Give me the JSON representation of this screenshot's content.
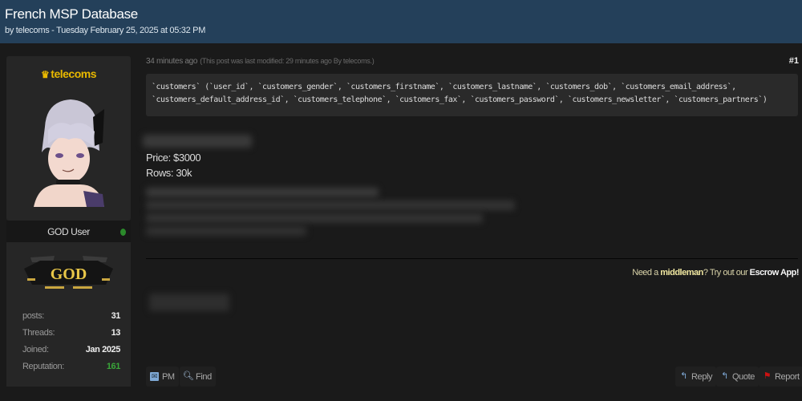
{
  "thread": {
    "title": "French MSP Database",
    "byline": "by telecoms - Tuesday February 25, 2025 at 05:32 PM"
  },
  "author": {
    "username": "telecoms",
    "crown_icon": "crown-icon",
    "rank_title": "GOD User",
    "online": true,
    "badge_text": "GOD",
    "stats": [
      {
        "label": "posts:",
        "value": "31"
      },
      {
        "label": "Threads:",
        "value": "13"
      },
      {
        "label": "Joined:",
        "value": "Jan 2025"
      },
      {
        "label": "Reputation:",
        "value": "161"
      }
    ],
    "reputation_color": "#3aa53a"
  },
  "post": {
    "time": "34 minutes ago",
    "modified_note": "(This post was last modified: 29 minutes ago By telecoms.)",
    "number": "#1",
    "code_lines": [
      "`customers` (`user_id`, `customers_gender`, `customers_firstname`, `customers_lastname`, `customers_dob`, `customers_email_address`,",
      "`customers_default_address_id`, `customers_telephone`, `customers_fax`, `customers_password`, `customers_newsletter`, `customers_partners`)"
    ],
    "price": "Price: $3000",
    "rows": "Rows: 30k",
    "promo": {
      "prefix": "Need a ",
      "middleman": "middleman",
      "middle": "? Try out our ",
      "app": "Escrow App!"
    }
  },
  "buttons": {
    "pm": "PM",
    "find": "Find",
    "reply": "Reply",
    "quote": "Quote",
    "report": "Report"
  },
  "colors": {
    "header_bg": "#24405a",
    "username": "#e8b800",
    "report_flag": "#cc1111",
    "reply_icon": "#7fa9d6"
  }
}
